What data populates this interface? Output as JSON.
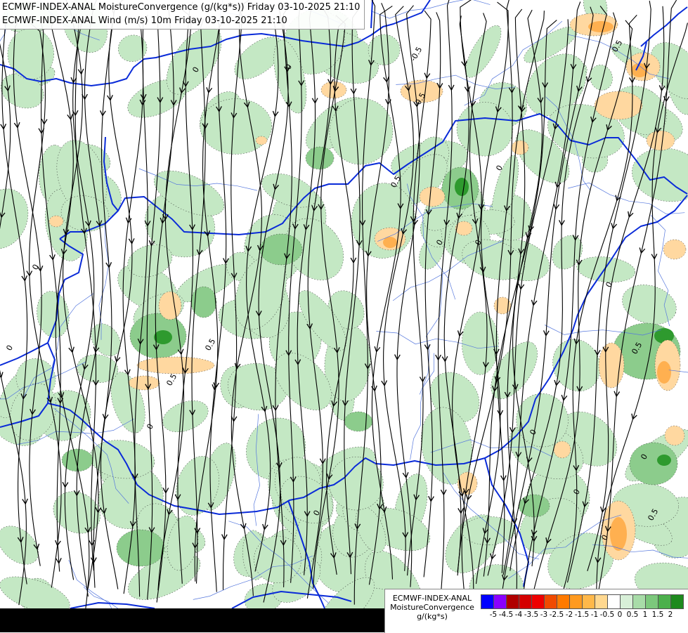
{
  "header": {
    "line1": "ECMWF-INDEX-ANAL MoistureConvergence (g/(kg*s)) Friday 03-10-2025 21:10",
    "line2": "ECMWF-INDEX-ANAL Wind (m/s) 10m Friday 03-10-2025 21:10"
  },
  "legend": {
    "title_line1": "ECMWF-INDEX-ANAL",
    "title_line2": "MoistureConvergence",
    "units": "g/(kg*s)",
    "colors": [
      "#0000ff",
      "#8a00ff",
      "#b00000",
      "#d40000",
      "#ee0000",
      "#f04a00",
      "#ff7a00",
      "#ff9a20",
      "#ffb84a",
      "#ffd890",
      "#ffffff",
      "#d8f0d8",
      "#a8dca8",
      "#7cc87c",
      "#4cb04c",
      "#1e8a1e"
    ],
    "labels": [
      "-5",
      "-4.5",
      "-4",
      "-3.5",
      "-3",
      "-2.5",
      "-2",
      "-1.5",
      "-1",
      "-0.5",
      "0",
      "0.5",
      "1",
      "1.5",
      "2"
    ]
  },
  "map_labels": {
    "contour_zero": "0",
    "contour_half": "0.5",
    "contour_neg_half": "-0.5"
  },
  "colors": {
    "border": "#0a2bd8",
    "river": "#5577dd",
    "streamline": "#000000",
    "green_light": "#c4e8c4",
    "green_mid": "#8ccc8c",
    "green_dark": "#2e9a2e",
    "orange_light": "#ffd8a0",
    "orange_mid": "#ffb050"
  }
}
